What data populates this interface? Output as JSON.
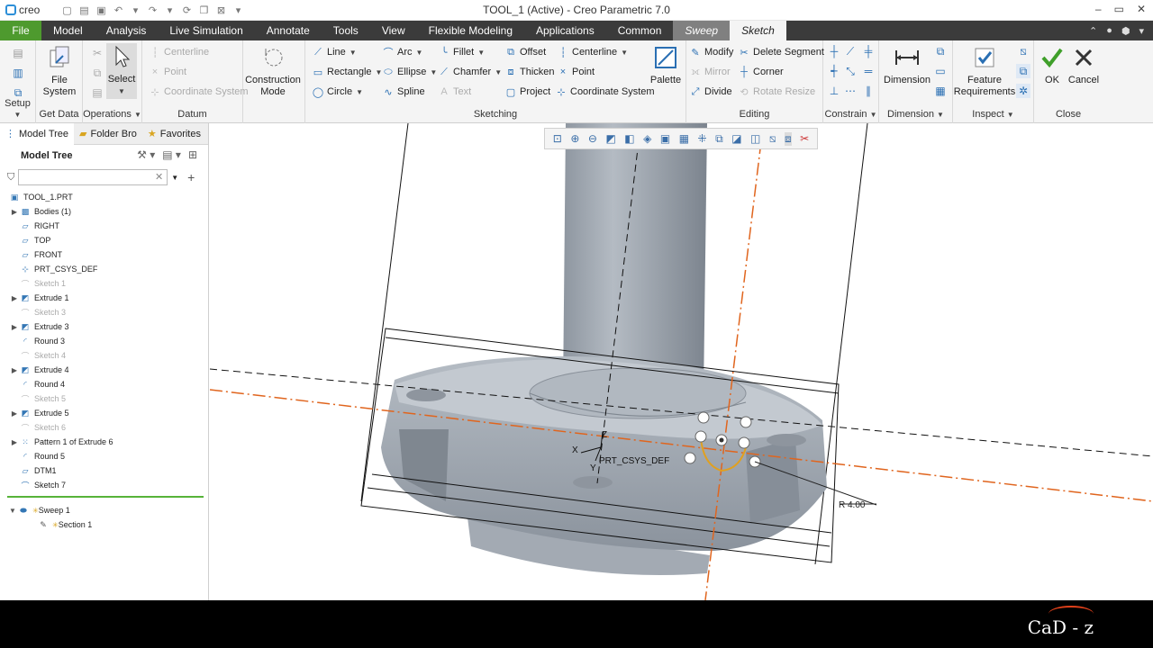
{
  "app": {
    "logo_text": "creo",
    "window_title": "TOOL_1 (Active) - Creo Parametric 7.0",
    "controls": [
      "–",
      "▭",
      "✕"
    ]
  },
  "ribbon_tabs": [
    "File",
    "Model",
    "Analysis",
    "Live Simulation",
    "Annotate",
    "Tools",
    "View",
    "Flexible Modeling",
    "Applications",
    "Common",
    "Sweep",
    "Sketch"
  ],
  "ribbon": {
    "setup": "Setup",
    "get_data": {
      "file_system": "File System",
      "label": "Get Data"
    },
    "operations": {
      "select": "Select",
      "label": "Operations"
    },
    "datum": {
      "centerline": "Centerline",
      "point": "Point",
      "coord_sys": "Coordinate System",
      "label": "Datum"
    },
    "construction_mode": "Construction Mode",
    "sketching": {
      "line": "Line",
      "rectangle": "Rectangle",
      "circle": "Circle",
      "arc": "Arc",
      "ellipse": "Ellipse",
      "spline": "Spline",
      "fillet": "Fillet",
      "chamfer": "Chamfer",
      "text": "Text",
      "offset": "Offset",
      "thicken": "Thicken",
      "project": "Project",
      "centerline": "Centerline",
      "point": "Point",
      "coord_sys": "Coordinate System",
      "palette": "Palette",
      "label": "Sketching"
    },
    "editing": {
      "modify": "Modify",
      "mirror": "Mirror",
      "divide": "Divide",
      "delete_segment": "Delete Segment",
      "corner": "Corner",
      "rotate_resize": "Rotate Resize",
      "label": "Editing"
    },
    "constrain": "Constrain",
    "dimension": {
      "button": "Dimension",
      "label": "Dimension"
    },
    "inspect": {
      "feature_req": "Feature Requirements",
      "label": "Inspect"
    },
    "close": {
      "ok": "OK",
      "cancel": "Cancel",
      "label": "Close"
    }
  },
  "panel": {
    "tabs": [
      "Model Tree",
      "Folder Bro",
      "Favorites"
    ],
    "title": "Model Tree",
    "search_placeholder": "",
    "tree": [
      {
        "label": "TOOL_1.PRT",
        "icon": "part-icon",
        "dim": false,
        "exp": ""
      },
      {
        "label": "Bodies (1)",
        "icon": "bodies-icon",
        "dim": false,
        "exp": "▶"
      },
      {
        "label": "RIGHT",
        "icon": "plane-icon",
        "dim": false,
        "exp": ""
      },
      {
        "label": "TOP",
        "icon": "plane-icon",
        "dim": false,
        "exp": ""
      },
      {
        "label": "FRONT",
        "icon": "plane-icon",
        "dim": false,
        "exp": ""
      },
      {
        "label": "PRT_CSYS_DEF",
        "icon": "csys-icon",
        "dim": false,
        "exp": ""
      },
      {
        "label": "Sketch 1",
        "icon": "sketch-icon",
        "dim": true,
        "exp": ""
      },
      {
        "label": "Extrude 1",
        "icon": "extrude-icon",
        "dim": false,
        "exp": "▶"
      },
      {
        "label": "Sketch 3",
        "icon": "sketch-icon",
        "dim": true,
        "exp": ""
      },
      {
        "label": "Extrude 3",
        "icon": "extrude-icon",
        "dim": false,
        "exp": "▶"
      },
      {
        "label": "Round 3",
        "icon": "round-icon",
        "dim": false,
        "exp": ""
      },
      {
        "label": "Sketch 4",
        "icon": "sketch-icon",
        "dim": true,
        "exp": ""
      },
      {
        "label": "Extrude 4",
        "icon": "extrude-icon",
        "dim": false,
        "exp": "▶"
      },
      {
        "label": "Round 4",
        "icon": "round-icon",
        "dim": false,
        "exp": ""
      },
      {
        "label": "Sketch 5",
        "icon": "sketch-icon",
        "dim": true,
        "exp": ""
      },
      {
        "label": "Extrude 5",
        "icon": "extrude-icon",
        "dim": false,
        "exp": "▶"
      },
      {
        "label": "Sketch 6",
        "icon": "sketch-icon",
        "dim": true,
        "exp": ""
      },
      {
        "label": "Pattern 1 of Extrude 6",
        "icon": "pattern-icon",
        "dim": false,
        "exp": "▶"
      },
      {
        "label": "Round 5",
        "icon": "round-icon",
        "dim": false,
        "exp": ""
      },
      {
        "label": "DTM1",
        "icon": "plane-icon",
        "dim": false,
        "exp": ""
      },
      {
        "label": "Sketch 7",
        "icon": "sketch-icon",
        "dim": false,
        "exp": ""
      }
    ],
    "sweep": {
      "label": "Sweep 1",
      "section": "Section 1"
    }
  },
  "graphics": {
    "csys_label": "PRT_CSYS_DEF",
    "axis_x": "X",
    "axis_y": "Y",
    "axis_z": "Z",
    "radius_dim": "R 4.00"
  },
  "brand": "CaD - z"
}
